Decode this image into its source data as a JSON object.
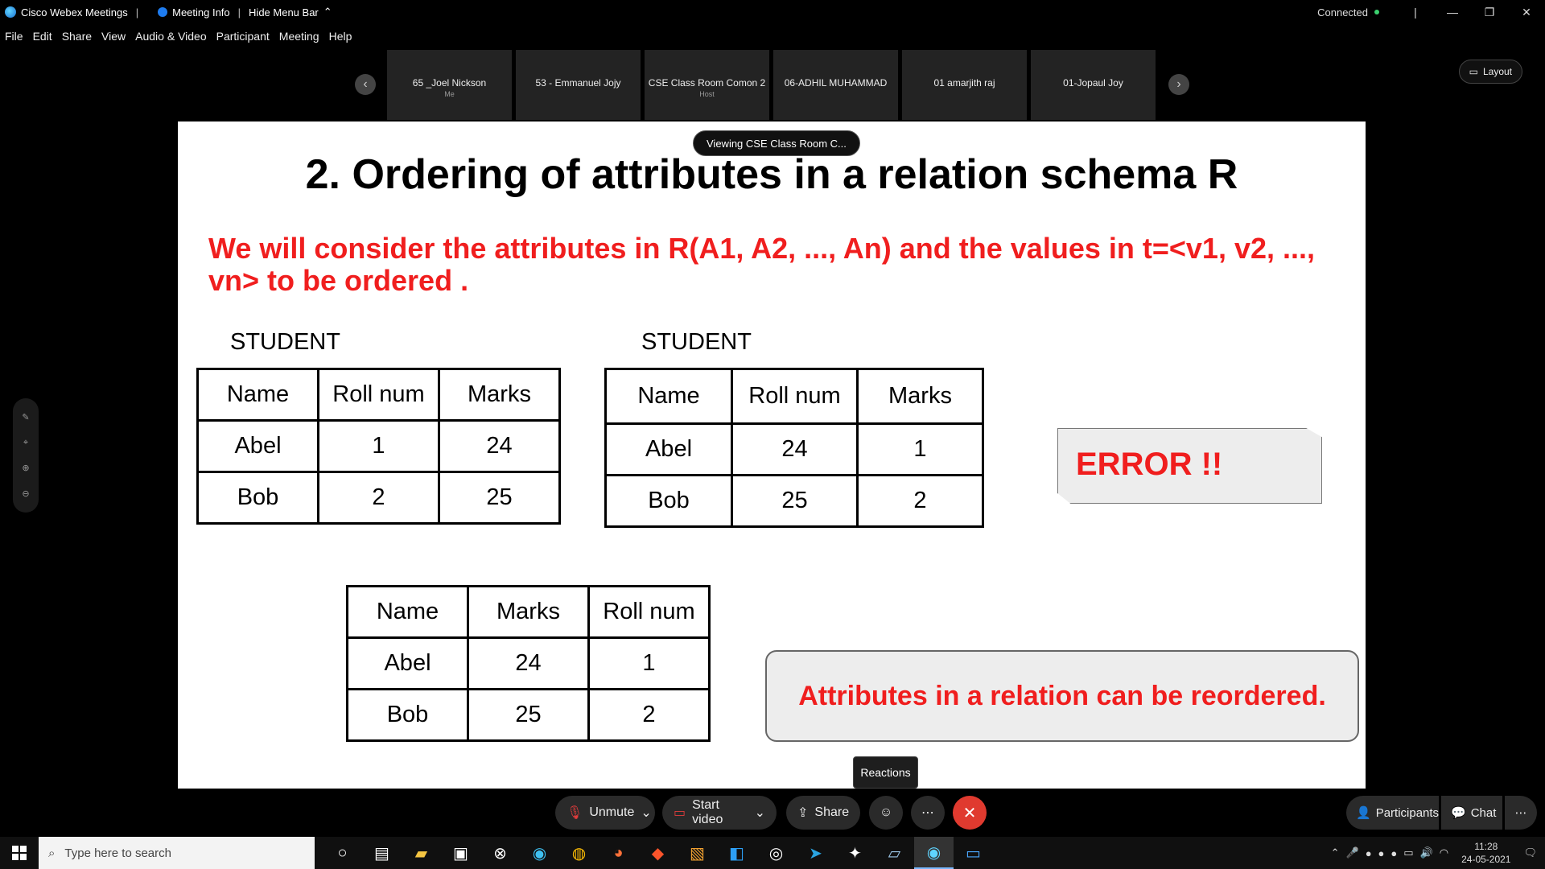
{
  "app": {
    "title": "Cisco Webex Meetings",
    "meeting_info": "Meeting Info",
    "hide_menu_bar": "Hide Menu Bar",
    "connection_status": "Connected"
  },
  "menu": [
    "File",
    "Edit",
    "Share",
    "View",
    "Audio & Video",
    "Participant",
    "Meeting",
    "Help"
  ],
  "participants": [
    {
      "name": "65 _Joel Nickson",
      "role": "Me"
    },
    {
      "name": "53 - Emmanuel Jojy",
      "role": ""
    },
    {
      "name": "CSE Class Room Comon 2",
      "role": "Host"
    },
    {
      "name": "06-ADHIL MUHAMMAD",
      "role": ""
    },
    {
      "name": "01 amarjith raj",
      "role": ""
    },
    {
      "name": "01-Jopaul Joy",
      "role": ""
    }
  ],
  "layout_label": "Layout",
  "viewing_label": "Viewing CSE Class Room C...",
  "slide": {
    "title": "2. Ordering of attributes in a relation schema R",
    "description": "We will consider the attributes in R(A1, A2, ..., An) and the values in t=<v1, v2, ..., vn> to be ordered .",
    "table1": {
      "caption": "STUDENT",
      "header": [
        "Name",
        "Roll num",
        "Marks"
      ],
      "rows": [
        [
          "Abel",
          "1",
          "24"
        ],
        [
          "Bob",
          "2",
          "25"
        ]
      ]
    },
    "table2": {
      "caption": "STUDENT",
      "header": [
        "Name",
        "Roll num",
        "Marks"
      ],
      "rows": [
        [
          "Abel",
          "24",
          "1"
        ],
        [
          "Bob",
          "25",
          "2"
        ]
      ]
    },
    "table3": {
      "header": [
        "Name",
        "Marks",
        "Roll num"
      ],
      "rows": [
        [
          "Abel",
          "24",
          "1"
        ],
        [
          "Bob",
          "25",
          "2"
        ]
      ]
    },
    "error_text": "ERROR !!",
    "note_text": "Attributes in a relation can be reordered."
  },
  "reactions_label": "Reactions",
  "controls": {
    "unmute": "Unmute",
    "start_video": "Start video",
    "share": "Share",
    "participants": "Participants",
    "chat": "Chat"
  },
  "taskbar": {
    "search_placeholder": "Type here to search",
    "time": "11:28",
    "date": "24-05-2021"
  },
  "colors": {
    "slide_red": "#f01e1e",
    "end_button": "#e03a2f",
    "connected": "#3bd16f"
  }
}
